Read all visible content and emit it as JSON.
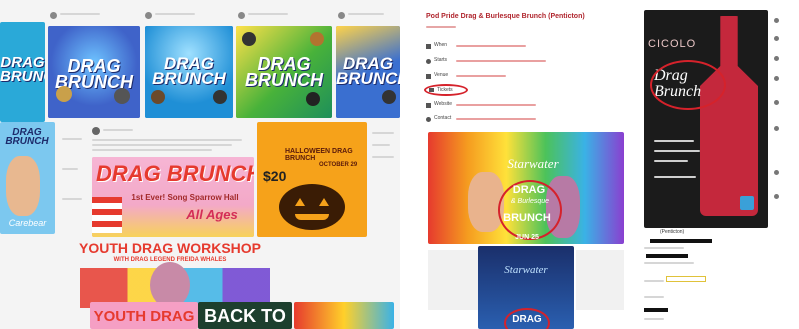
{
  "left_feed": {
    "tiles": [
      {
        "title": "DRAG\nBRUNCH",
        "color": "#2aa9d8"
      },
      {
        "title": "DRAG\nBRUNCH",
        "color": "#3f63c9"
      },
      {
        "title": "DRAG\nBRUNCH",
        "color": "#1f8fd6"
      },
      {
        "title": "DRAG\nBRUNCH",
        "color": "#48b23a"
      },
      {
        "title": "DRAG\nBRUNCH",
        "color": "#3a6fd0"
      }
    ],
    "second_row_left_title": "DRAG\nBRUNCH",
    "second_row_left_subtitle": "Carebear",
    "main_poster": {
      "title": "DRAG BRUNCH",
      "line2": "1st Ever!  Song Sparrow Hall",
      "line3": "All Ages"
    },
    "halloween_poster": {
      "price": "$20",
      "title": "HALLOWEEN DRAG BRUNCH",
      "date": "OCTOBER 29"
    },
    "workshop_banner": {
      "title": "YOUTH DRAG WORKSHOP",
      "subtitle": "WITH DRAG LEGEND FREIDA WHALES"
    },
    "bottom_tiles": [
      "YOUTH DRAG",
      "BACK TO"
    ]
  },
  "event": {
    "title": "Pod Pride Drag & Burlesque Brunch (Penticton)",
    "rows": [
      {
        "icon": "calendar-icon",
        "label": "When"
      },
      {
        "icon": "clock-icon",
        "label": "Starts"
      },
      {
        "icon": "location-icon",
        "label": "Venue"
      },
      {
        "icon": "ticket-icon",
        "label": "Tickets"
      },
      {
        "icon": "link-icon",
        "label": "Website"
      },
      {
        "icon": "user-icon",
        "label": "Contact"
      }
    ],
    "poster_top": {
      "brand": "Starwater",
      "title1": "DRAG",
      "title2": "& Burlesque",
      "title3": "BRUNCH",
      "date": "JUN 25"
    },
    "poster_bottom": {
      "brand": "Starwater",
      "title": "DRAG"
    }
  },
  "right_post": {
    "poster": {
      "brand": "CICOLO",
      "title": "Drag\nBrunch"
    },
    "author_label": "(Penticton)"
  },
  "colors": {
    "drag_blue": "#2aa9d8",
    "orange": "#f6a21a",
    "red": "#e63a2e",
    "wine": "#c4283c"
  }
}
